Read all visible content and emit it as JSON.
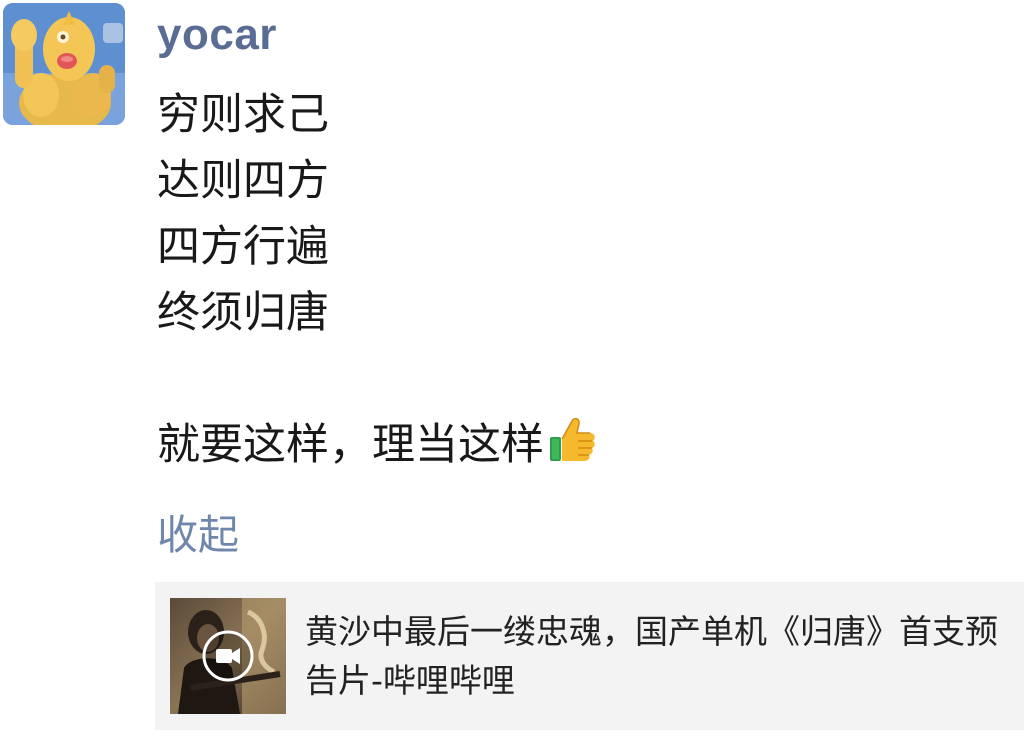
{
  "post": {
    "username": "yocar",
    "lines": [
      "穷则求己",
      "达则四方",
      "四方行遍",
      "终须归唐"
    ],
    "closing_line": "就要这样，理当这样",
    "closing_emoji": "thumbs-up-icon",
    "collapse_label": "收起"
  },
  "link_card": {
    "title": "黄沙中最后一缕忠魂，国产单机《归唐》首支预告片-哔哩哔哩",
    "thumbnail_icon": "video-camera-icon"
  },
  "colors": {
    "username": "#586c94",
    "link": "#6f86ad",
    "card_background": "#f3f3f3",
    "text": "#191919"
  }
}
